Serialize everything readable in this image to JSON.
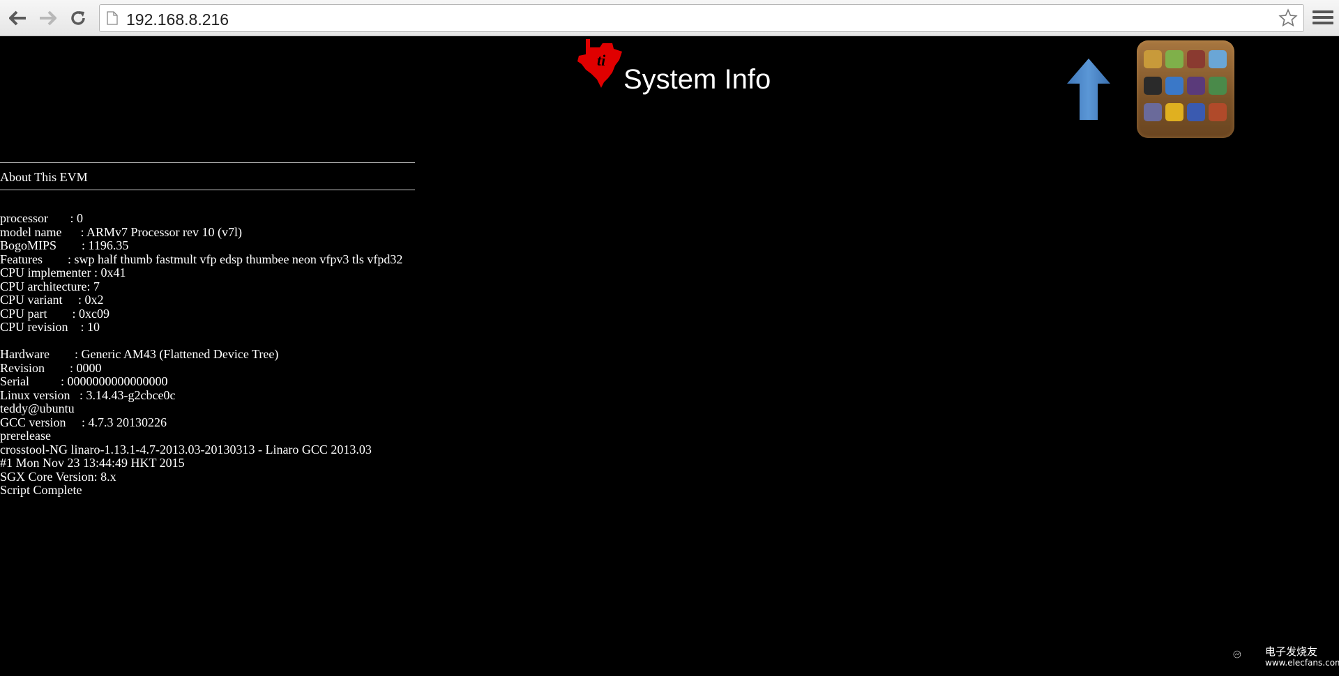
{
  "browser": {
    "url": "192.168.8.216",
    "icons": [
      "back-icon",
      "forward-icon",
      "reload-icon",
      "page-icon",
      "bookmark-star-icon",
      "menu-icon"
    ]
  },
  "header": {
    "title": "System Info",
    "logo": "ti-logo-icon",
    "up_button_icon": "up-arrow-icon",
    "launcher_icon": "app-launcher-icon"
  },
  "terminal": {
    "section_heading": "About This EVM",
    "lines": [
      "processor       : 0",
      "model name      : ARMv7 Processor rev 10 (v7l)",
      "BogoMIPS        : 1196.35",
      "Features        : swp half thumb fastmult vfp edsp thumbee neon vfpv3 tls vfpd32",
      "CPU implementer : 0x41",
      "CPU architecture: 7",
      "CPU variant     : 0x2",
      "CPU part        : 0xc09",
      "CPU revision    : 10",
      "",
      "Hardware        : Generic AM43 (Flattened Device Tree)",
      "Revision        : 0000",
      "Serial          : 0000000000000000",
      "Linux version   : 3.14.43-g2cbce0c",
      "teddy@ubuntu",
      "GCC version     : 4.7.3 20130226",
      "prerelease",
      "crosstool-NG linaro-1.13.1-4.7-2013.03-20130313 - Linaro GCC 2013.03",
      "#1 Mon Nov 23 13:44:49 HKT 2015",
      "SGX Core Version: 8.x",
      "Script Complete"
    ]
  },
  "watermark": {
    "text": "电子发烧友",
    "sub": "www.elecfans.com"
  },
  "colors": {
    "page_bg": "#000000",
    "text": "#ffffff",
    "logo_red": "#e00000",
    "arrow_blue": "#4a86c8"
  }
}
